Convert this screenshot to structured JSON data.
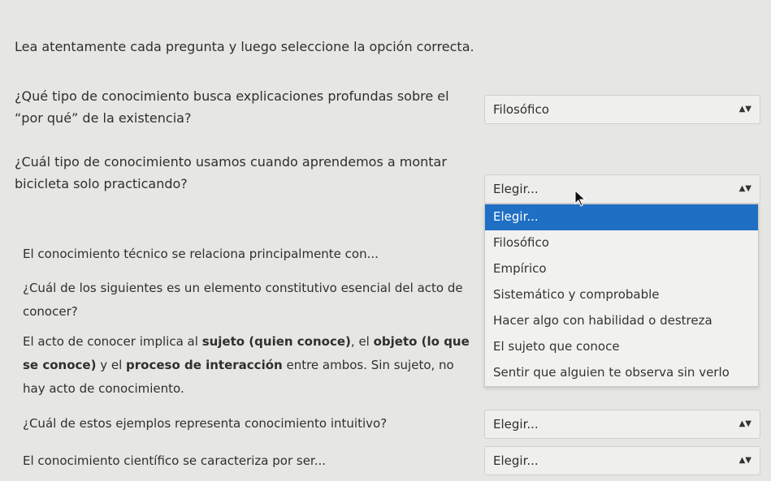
{
  "instructions": "Lea atentamente cada pregunta y luego seleccione la opción correcta.",
  "questions": [
    {
      "text": "¿Qué tipo de conocimiento busca explicaciones profundas sobre el “por qué” de la existencia?",
      "selected": "Filosófico"
    },
    {
      "text": "¿Cuál tipo de conocimiento usamos cuando aprendemos a montar bicicleta solo practicando?",
      "selected": "Elegir..."
    },
    {
      "text": "El conocimiento técnico se relaciona principalmente con..."
    },
    {
      "text": "¿Cuál de los siguientes es un elemento constitutivo esencial del acto de conocer?"
    },
    {
      "part1": "El acto de conocer implica al ",
      "bold1": "sujeto (quien conoce)",
      "part2": ", el ",
      "bold2": "objeto (lo que se conoce)",
      "part3": " y el ",
      "bold3": "proceso de interacción",
      "part4": " entre ambos. Sin sujeto, no hay acto de conocimiento."
    },
    {
      "text": "¿Cuál de estos ejemplos representa conocimiento intuitivo?",
      "selected": "Elegir..."
    },
    {
      "text": "El conocimiento científico se caracteriza por ser...",
      "selected": "Elegir..."
    }
  ],
  "dropdown_options": [
    "Elegir...",
    "Filosófico",
    "Empírico",
    "Sistemático y comprobable",
    "Hacer algo con habilidad o destreza",
    "El sujeto que conoce",
    "Sentir que alguien te observa sin verlo"
  ],
  "highlighted_option": "Elegir...",
  "colors": {
    "highlight": "#1f6fc5",
    "background": "#e6e6e3"
  },
  "icons": {
    "select_arrow": "updown-arrow-icon",
    "cursor": "mouse-pointer-icon"
  }
}
